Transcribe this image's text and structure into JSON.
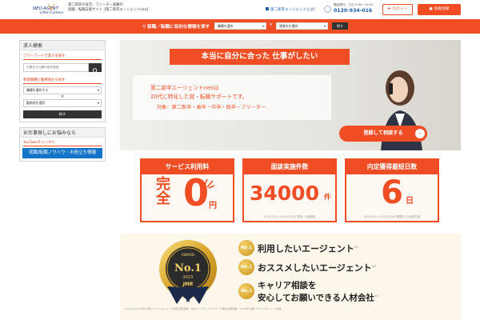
{
  "header": {
    "logo_tagline": "Lifes Careers",
    "desc_line1": "第二新卒の就活、フリーター就職の",
    "desc_line2": "就職／転職支援サイト【第二新卒エージェントneo】",
    "top_link": "第二新卒エージェントとは？",
    "phone_note": "電話受付：平日 9:00～19:00",
    "phone_number": "0120-934-016",
    "login_label": "ログイン",
    "register_label": "会員登録"
  },
  "searchbar": {
    "label": "就職／転職に有利な情報を探す",
    "select1": "職種を選択",
    "select2": "就業先を選択",
    "x": "×",
    "button": "探す"
  },
  "sidebar": {
    "job_search_title": "求人検索",
    "free_word_label": "フリーワードで求人を探す",
    "keyword_placeholder": "企業名や仕事内容を検索",
    "area_label": "希望職種と勤務地から探す",
    "occupation_select": "職種を選択する",
    "x": "×",
    "location_select": "勤務地を選択",
    "search_button": "探す",
    "help_title": "お仕事探しにお悩みなら",
    "youtube_label": "YouTubeチャンネル",
    "youtube_banner": "就職/転職ノウハウ・お役立ち情報"
  },
  "hero": {
    "title": "本当に自分に合った 仕事がしたい",
    "line1": "第二新卒エージェントneoは",
    "line2": "20代に特化した就・転職サポートです。",
    "line3": "対象：第二新卒・高卒・中卒・既卒・フリーター",
    "cta": "登録して相談する"
  },
  "stats": [
    {
      "head": "サービス利用料",
      "big": "完全",
      "value": "0",
      "unit": "円",
      "note": ""
    },
    {
      "head": "面談実施件数",
      "value": "34000",
      "unit": "件",
      "note": "※2017/1/1～2023/2/28に実施した面談数"
    },
    {
      "head": "内定獲得最短日数",
      "value": "6",
      "unit": "日",
      "note": "※2022/3/1～2023/2/28の期間中での最短日数"
    }
  ],
  "award": {
    "medal_award": "AWARD",
    "medal_no1": "No.1",
    "medal_year": "2023",
    "medal_brand": "JMR",
    "badge": "No.1",
    "items": [
      {
        "text": "利用したいエージェント",
        "sup": "※1"
      },
      {
        "text": "おススメしたいエージェント",
        "sup": "※2"
      },
      {
        "text": "キャリア相談を",
        "text2": "安心してお願いできる人材会社",
        "sup": "※3"
      }
    ],
    "footnote": "※1※2※3 2023年2月期 ブランドのイメージ調査 調査機関：日本マーケティングリサーチ機構 調査概要：2023年2月期 ブランドのイメージ調査"
  },
  "colors": {
    "accent": "#f04d24",
    "dark_button": "#333333",
    "link_blue": "#1b5eb0",
    "youtube_blue": "#1474c8",
    "award_bg": "#fdf6ea"
  }
}
